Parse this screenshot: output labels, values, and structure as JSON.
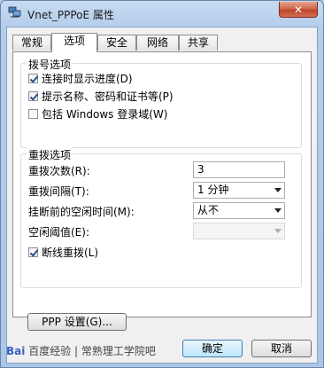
{
  "window": {
    "title": "Vnet_PPPoE 属性",
    "close_label": "✕"
  },
  "tabs": [
    "常规",
    "选项",
    "安全",
    "网络",
    "共享"
  ],
  "dialing": {
    "title": "拨号选项",
    "items": [
      {
        "label": "连接时显示进度(D)",
        "checked": true
      },
      {
        "label": "提示名称、密码和证书等(P)",
        "checked": true
      },
      {
        "label": "包括 Windows 登录域(W)",
        "checked": false
      }
    ]
  },
  "redial": {
    "title": "重拨选项",
    "attempts_label": "重拨次数(R):",
    "attempts_value": "3",
    "interval_label": "重拨间隔(T):",
    "interval_value": "1 分钟",
    "idle_hangup_label": "挂断前的空闲时间(M):",
    "idle_hangup_value": "从不",
    "idle_threshold_label": "空闲阈值(E):",
    "idle_threshold_value": "",
    "redial_if_dropped_label": "断线重拨(L)",
    "redial_if_dropped_checked": true
  },
  "ppp_button": "PPP 设置(G)...",
  "ok_button": "确定",
  "cancel_button": "取消",
  "watermark": {
    "logo": "Bai",
    "text": "百度经验 | 常熟理工学院吧"
  }
}
